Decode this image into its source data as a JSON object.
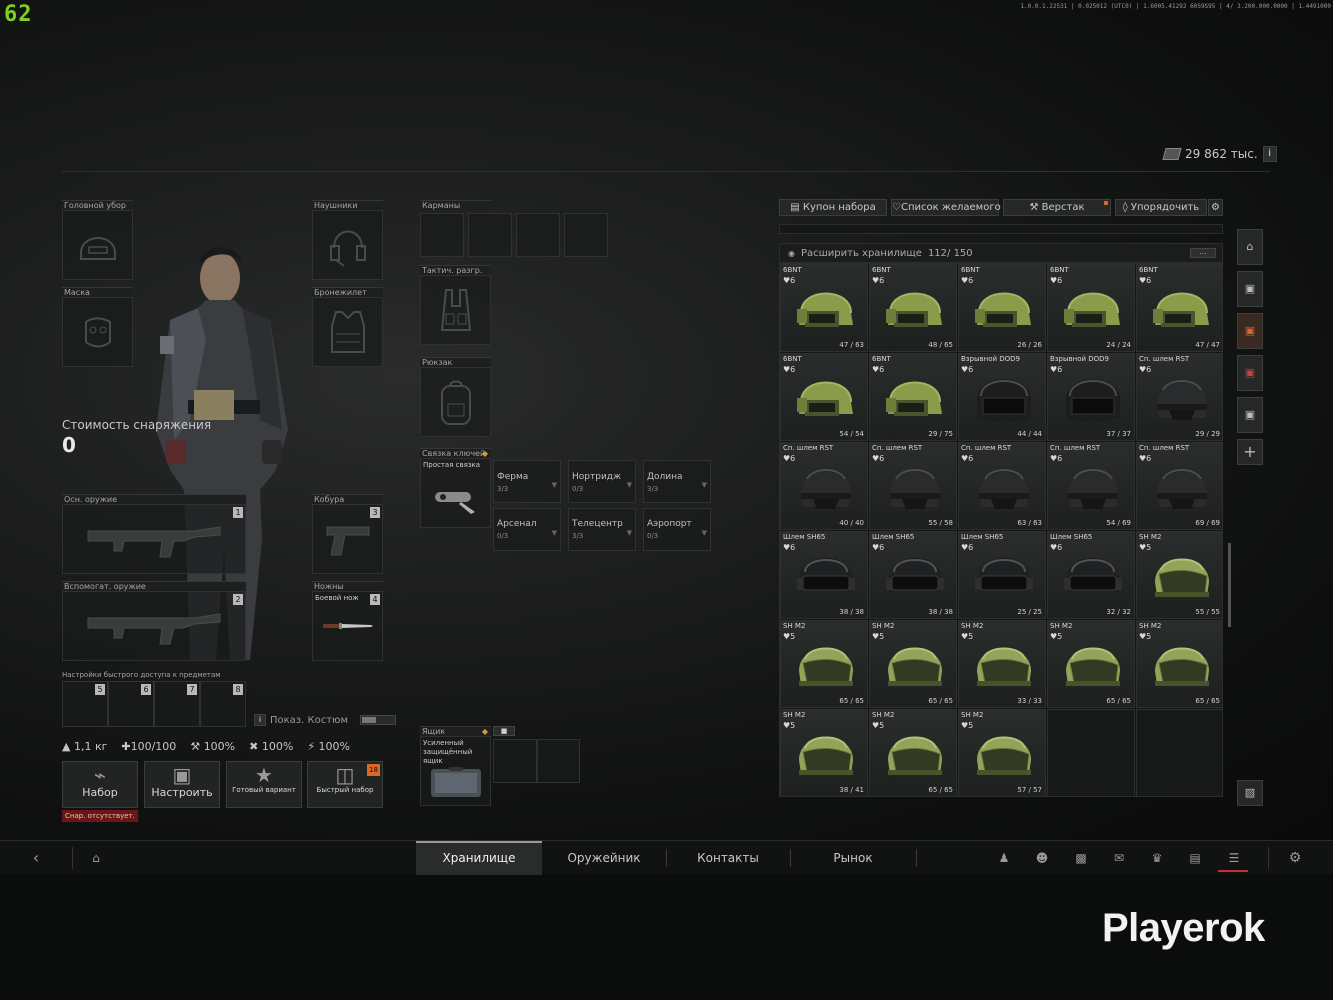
{
  "fps": "62",
  "top_info": "1.0.0.1.22531 | 0.025012 (UTC0) | 1.6005.41292 6059S95 | 4/ 3.200.000.0000 | 1.4491000",
  "money": {
    "amount": "29 862 тыс."
  },
  "info_button": "i",
  "gear": {
    "headwear": "Головной убор",
    "headphones": "Наушники",
    "mask": "Маска",
    "armor": "Бронежилет",
    "equip_value_label": "Стоимость снаряжения",
    "equip_value": "0",
    "primary": "Осн. оружие",
    "primary_num": "1",
    "holster": "Кобура",
    "holster_num": "3",
    "secondary": "Вспомогат. оружие",
    "secondary_num": "2",
    "knives": "Ножны",
    "knife_name": "Боевой нож",
    "knife_num": "4",
    "quick_access": "Настройки быстрого доступа к предметам",
    "quick_nums": [
      "5",
      "6",
      "7",
      "8"
    ],
    "show_costume": "Показ. Костюм"
  },
  "stats": {
    "weight": "1,1 кг",
    "health": "100/100",
    "repair": "100%",
    "stat3": "100%",
    "stat4": "100%"
  },
  "buttons": {
    "kit": "Набор",
    "configure": "Настроить",
    "ready": "Готовый вариант",
    "quick_kit": "Быстрый набор",
    "quick_kit_badge": "18",
    "no_kit": "Снар. отсутствует."
  },
  "containers": {
    "pockets": "Карманы",
    "rig": "Тактич. разгр.",
    "backpack": "Рюкзак",
    "keyring": "Связка ключей",
    "keyring_item": "Простая связка",
    "keys": [
      {
        "name": "Ферма",
        "count": "3/3"
      },
      {
        "name": "Нортридж",
        "count": "0/3"
      },
      {
        "name": "Долина",
        "count": "3/3"
      },
      {
        "name": "Арсенал",
        "count": "0/3"
      },
      {
        "name": "Телецентр",
        "count": "3/3"
      },
      {
        "name": "Аэропорт",
        "count": "0/3"
      }
    ],
    "box": "Ящик",
    "box_item": "Усиленный защищённый ящик"
  },
  "toolbar": {
    "coupon": "Купон набора",
    "wishlist": "Список желаемого",
    "workbench": "Верстак",
    "sort": "Упорядочить"
  },
  "stash": {
    "expand": "Расширить хранилище",
    "capacity": "112/ 150",
    "more": "...",
    "items": [
      {
        "name": "6BNT",
        "cls": "6",
        "dur": "47 / 63",
        "type": "bnt"
      },
      {
        "name": "6BNT",
        "cls": "6",
        "dur": "48 / 65",
        "type": "bnt"
      },
      {
        "name": "6BNT",
        "cls": "6",
        "dur": "26 / 26",
        "type": "bnt"
      },
      {
        "name": "6BNT",
        "cls": "6",
        "dur": "24 / 24",
        "type": "bnt"
      },
      {
        "name": "6BNT",
        "cls": "6",
        "dur": "47 / 47",
        "type": "bnt"
      },
      {
        "name": "6BNT",
        "cls": "6",
        "dur": "54 / 54",
        "type": "bnt"
      },
      {
        "name": "6BNT",
        "cls": "6",
        "dur": "29 / 75",
        "type": "bnt"
      },
      {
        "name": "Взрывной DOD9",
        "cls": "6",
        "dur": "44 / 44",
        "type": "dod"
      },
      {
        "name": "Взрывной DOD9",
        "cls": "6",
        "dur": "37 / 37",
        "type": "dod"
      },
      {
        "name": "Сп. шлем RST",
        "cls": "6",
        "dur": "29 / 29",
        "type": "rst"
      },
      {
        "name": "Сп. шлем RST",
        "cls": "6",
        "dur": "40 / 40",
        "type": "rst"
      },
      {
        "name": "Сп. шлем RST",
        "cls": "6",
        "dur": "55 / 58",
        "type": "rst"
      },
      {
        "name": "Сп. шлем RST",
        "cls": "6",
        "dur": "63 / 63",
        "type": "rst"
      },
      {
        "name": "Сп. шлем RST",
        "cls": "6",
        "dur": "54 / 69",
        "type": "rst"
      },
      {
        "name": "Сп. шлем RST",
        "cls": "6",
        "dur": "69 / 69",
        "type": "rst"
      },
      {
        "name": "Шлем SH65",
        "cls": "6",
        "dur": "38 / 38",
        "type": "sh65"
      },
      {
        "name": "Шлем SH65",
        "cls": "6",
        "dur": "38 / 38",
        "type": "sh65"
      },
      {
        "name": "Шлем SH65",
        "cls": "6",
        "dur": "25 / 25",
        "type": "sh65"
      },
      {
        "name": "Шлем SH65",
        "cls": "6",
        "dur": "32 / 32",
        "type": "sh65"
      },
      {
        "name": "SH M2",
        "cls": "5",
        "dur": "55 / 55",
        "type": "shm2"
      },
      {
        "name": "SH M2",
        "cls": "5",
        "dur": "65 / 65",
        "type": "shm2"
      },
      {
        "name": "SH M2",
        "cls": "5",
        "dur": "65 / 65",
        "type": "shm2"
      },
      {
        "name": "SH M2",
        "cls": "5",
        "dur": "33 / 33",
        "type": "shm2"
      },
      {
        "name": "SH M2",
        "cls": "5",
        "dur": "65 / 65",
        "type": "shm2"
      },
      {
        "name": "SH M2",
        "cls": "5",
        "dur": "65 / 65",
        "type": "shm2"
      },
      {
        "name": "SH M2",
        "cls": "5",
        "dur": "38 / 41",
        "type": "shm2"
      },
      {
        "name": "SH M2",
        "cls": "5",
        "dur": "65 / 65",
        "type": "shm2"
      },
      {
        "name": "SH M2",
        "cls": "5",
        "dur": "57 / 57",
        "type": "shm2"
      }
    ]
  },
  "nav": {
    "tabs": [
      "Хранилище",
      "Оружейник",
      "Контакты",
      "Рынок"
    ],
    "active": 0
  },
  "colors": {
    "accent": "#d9682a",
    "helmet_green": "#8a9c4a",
    "helmet_black": "#1c1d1e",
    "active_tab": "#2a2c2c"
  },
  "watermark": "Playerok"
}
